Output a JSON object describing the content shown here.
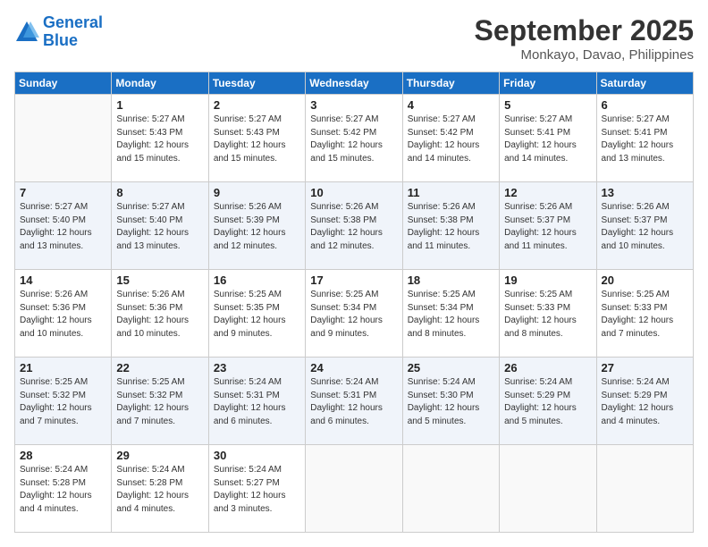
{
  "header": {
    "logo_line1": "General",
    "logo_line2": "Blue",
    "month": "September 2025",
    "location": "Monkayo, Davao, Philippines"
  },
  "days_of_week": [
    "Sunday",
    "Monday",
    "Tuesday",
    "Wednesday",
    "Thursday",
    "Friday",
    "Saturday"
  ],
  "weeks": [
    [
      {
        "num": "",
        "sunrise": "",
        "sunset": "",
        "daylight": ""
      },
      {
        "num": "1",
        "sunrise": "Sunrise: 5:27 AM",
        "sunset": "Sunset: 5:43 PM",
        "daylight": "Daylight: 12 hours and 15 minutes."
      },
      {
        "num": "2",
        "sunrise": "Sunrise: 5:27 AM",
        "sunset": "Sunset: 5:43 PM",
        "daylight": "Daylight: 12 hours and 15 minutes."
      },
      {
        "num": "3",
        "sunrise": "Sunrise: 5:27 AM",
        "sunset": "Sunset: 5:42 PM",
        "daylight": "Daylight: 12 hours and 15 minutes."
      },
      {
        "num": "4",
        "sunrise": "Sunrise: 5:27 AM",
        "sunset": "Sunset: 5:42 PM",
        "daylight": "Daylight: 12 hours and 14 minutes."
      },
      {
        "num": "5",
        "sunrise": "Sunrise: 5:27 AM",
        "sunset": "Sunset: 5:41 PM",
        "daylight": "Daylight: 12 hours and 14 minutes."
      },
      {
        "num": "6",
        "sunrise": "Sunrise: 5:27 AM",
        "sunset": "Sunset: 5:41 PM",
        "daylight": "Daylight: 12 hours and 13 minutes."
      }
    ],
    [
      {
        "num": "7",
        "sunrise": "Sunrise: 5:27 AM",
        "sunset": "Sunset: 5:40 PM",
        "daylight": "Daylight: 12 hours and 13 minutes."
      },
      {
        "num": "8",
        "sunrise": "Sunrise: 5:27 AM",
        "sunset": "Sunset: 5:40 PM",
        "daylight": "Daylight: 12 hours and 13 minutes."
      },
      {
        "num": "9",
        "sunrise": "Sunrise: 5:26 AM",
        "sunset": "Sunset: 5:39 PM",
        "daylight": "Daylight: 12 hours and 12 minutes."
      },
      {
        "num": "10",
        "sunrise": "Sunrise: 5:26 AM",
        "sunset": "Sunset: 5:38 PM",
        "daylight": "Daylight: 12 hours and 12 minutes."
      },
      {
        "num": "11",
        "sunrise": "Sunrise: 5:26 AM",
        "sunset": "Sunset: 5:38 PM",
        "daylight": "Daylight: 12 hours and 11 minutes."
      },
      {
        "num": "12",
        "sunrise": "Sunrise: 5:26 AM",
        "sunset": "Sunset: 5:37 PM",
        "daylight": "Daylight: 12 hours and 11 minutes."
      },
      {
        "num": "13",
        "sunrise": "Sunrise: 5:26 AM",
        "sunset": "Sunset: 5:37 PM",
        "daylight": "Daylight: 12 hours and 10 minutes."
      }
    ],
    [
      {
        "num": "14",
        "sunrise": "Sunrise: 5:26 AM",
        "sunset": "Sunset: 5:36 PM",
        "daylight": "Daylight: 12 hours and 10 minutes."
      },
      {
        "num": "15",
        "sunrise": "Sunrise: 5:26 AM",
        "sunset": "Sunset: 5:36 PM",
        "daylight": "Daylight: 12 hours and 10 minutes."
      },
      {
        "num": "16",
        "sunrise": "Sunrise: 5:25 AM",
        "sunset": "Sunset: 5:35 PM",
        "daylight": "Daylight: 12 hours and 9 minutes."
      },
      {
        "num": "17",
        "sunrise": "Sunrise: 5:25 AM",
        "sunset": "Sunset: 5:34 PM",
        "daylight": "Daylight: 12 hours and 9 minutes."
      },
      {
        "num": "18",
        "sunrise": "Sunrise: 5:25 AM",
        "sunset": "Sunset: 5:34 PM",
        "daylight": "Daylight: 12 hours and 8 minutes."
      },
      {
        "num": "19",
        "sunrise": "Sunrise: 5:25 AM",
        "sunset": "Sunset: 5:33 PM",
        "daylight": "Daylight: 12 hours and 8 minutes."
      },
      {
        "num": "20",
        "sunrise": "Sunrise: 5:25 AM",
        "sunset": "Sunset: 5:33 PM",
        "daylight": "Daylight: 12 hours and 7 minutes."
      }
    ],
    [
      {
        "num": "21",
        "sunrise": "Sunrise: 5:25 AM",
        "sunset": "Sunset: 5:32 PM",
        "daylight": "Daylight: 12 hours and 7 minutes."
      },
      {
        "num": "22",
        "sunrise": "Sunrise: 5:25 AM",
        "sunset": "Sunset: 5:32 PM",
        "daylight": "Daylight: 12 hours and 7 minutes."
      },
      {
        "num": "23",
        "sunrise": "Sunrise: 5:24 AM",
        "sunset": "Sunset: 5:31 PM",
        "daylight": "Daylight: 12 hours and 6 minutes."
      },
      {
        "num": "24",
        "sunrise": "Sunrise: 5:24 AM",
        "sunset": "Sunset: 5:31 PM",
        "daylight": "Daylight: 12 hours and 6 minutes."
      },
      {
        "num": "25",
        "sunrise": "Sunrise: 5:24 AM",
        "sunset": "Sunset: 5:30 PM",
        "daylight": "Daylight: 12 hours and 5 minutes."
      },
      {
        "num": "26",
        "sunrise": "Sunrise: 5:24 AM",
        "sunset": "Sunset: 5:29 PM",
        "daylight": "Daylight: 12 hours and 5 minutes."
      },
      {
        "num": "27",
        "sunrise": "Sunrise: 5:24 AM",
        "sunset": "Sunset: 5:29 PM",
        "daylight": "Daylight: 12 hours and 4 minutes."
      }
    ],
    [
      {
        "num": "28",
        "sunrise": "Sunrise: 5:24 AM",
        "sunset": "Sunset: 5:28 PM",
        "daylight": "Daylight: 12 hours and 4 minutes."
      },
      {
        "num": "29",
        "sunrise": "Sunrise: 5:24 AM",
        "sunset": "Sunset: 5:28 PM",
        "daylight": "Daylight: 12 hours and 4 minutes."
      },
      {
        "num": "30",
        "sunrise": "Sunrise: 5:24 AM",
        "sunset": "Sunset: 5:27 PM",
        "daylight": "Daylight: 12 hours and 3 minutes."
      },
      {
        "num": "",
        "sunrise": "",
        "sunset": "",
        "daylight": ""
      },
      {
        "num": "",
        "sunrise": "",
        "sunset": "",
        "daylight": ""
      },
      {
        "num": "",
        "sunrise": "",
        "sunset": "",
        "daylight": ""
      },
      {
        "num": "",
        "sunrise": "",
        "sunset": "",
        "daylight": ""
      }
    ]
  ]
}
